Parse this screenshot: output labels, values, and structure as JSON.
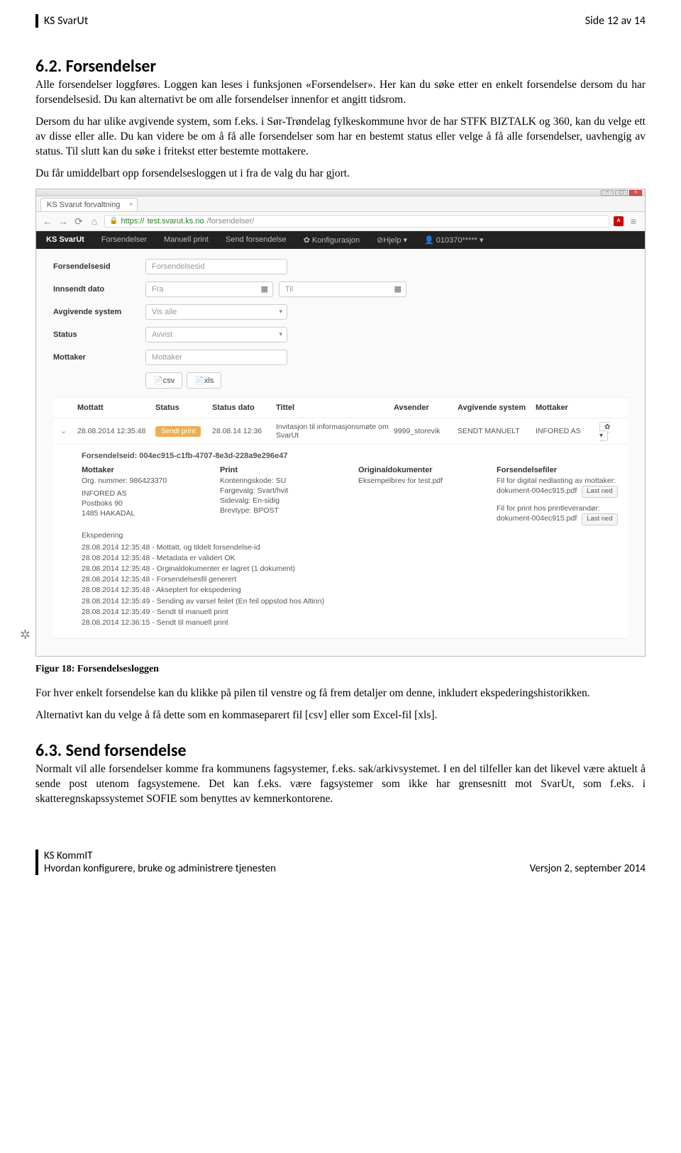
{
  "header": {
    "left": "KS SvarUt",
    "right": "Side 12 av 14"
  },
  "sec62": {
    "title": "6.2. Forsendelser",
    "p1": "Alle forsendelser loggføres. Loggen kan leses i funksjonen «Forsendelser». Her kan du søke etter en enkelt forsendelse dersom du har forsendelsesid. Du kan alternativt be om alle forsendelser innenfor et angitt tidsrom.",
    "p2": "Dersom du har ulike avgivende system, som f.eks. i Sør-Trøndelag fylkeskommune hvor de har STFK BIZTALK og 360, kan du velge ett av disse eller alle. Du kan videre be om å få alle forsendelser som har en bestemt status eller velge å få alle forsendelser, uavhengig av status. Til slutt kan du søke i fritekst etter bestemte mottakere.",
    "p3": "Du får umiddelbart opp forsendelsesloggen ut i fra de valg du har gjort."
  },
  "browser": {
    "tab_title": "KS Svarut forvaltning",
    "url_secure": "https://",
    "url_host": "test.svarut.ks.no",
    "url_path": "/forsendelser/"
  },
  "nav": {
    "brand": "KS SvarUt",
    "items": [
      "Forsendelser",
      "Manuell print",
      "Send forsendelse",
      "✿ Konfigurasjon",
      "⊘Hjelp ▾",
      "👤 010370***** ▾"
    ]
  },
  "filters": {
    "l_id": "Forsendelsesid",
    "ph_id": "Forsendelsesid",
    "l_date": "Innsendt dato",
    "ph_from": "Fra",
    "ph_to": "Til",
    "l_sys": "Avgivende system",
    "v_sys": "Vis alle",
    "l_status": "Status",
    "v_status": "Avvist",
    "l_mottaker": "Mottaker",
    "ph_mottaker": "Mottaker",
    "btn_csv": "📄csv",
    "btn_xls": "📄xls"
  },
  "table": {
    "h_mottatt": "Mottatt",
    "h_status": "Status",
    "h_statusdato": "Status dato",
    "h_tittel": "Tittel",
    "h_avsender": "Avsender",
    "h_avg": "Avgivende system",
    "h_mottaker": "Mottaker",
    "row": {
      "mottatt": "28.08.2014 12:35:48",
      "status": "Sendt print",
      "statusdato": "28.08.14 12:36",
      "tittel": "Invitasjon til informasjonsmøte om SvarUt",
      "avsender": "9999_storevik",
      "avg": "SENDT MANUELT",
      "mottaker": "INFORED AS"
    }
  },
  "detail": {
    "fid_label": "Forsendelseid: ",
    "fid": "004ec915-c1fb-4707-8e3d-228a9e296e47",
    "mottaker_h": "Mottaker",
    "mottaker_lines": [
      "Org. nummer: 986423370",
      "INFORED AS",
      "Postboks 90",
      "1485 HAKADAL"
    ],
    "print_h": "Print",
    "print_lines": [
      "Konteringskode: SU",
      "Fargevalg: Svart/hvit",
      "Sidevalg: En-sidig",
      "Brevtype: BPOST"
    ],
    "orig_h": "Originaldokumenter",
    "orig_lines": [
      "Eksempelbrev for test.pdf"
    ],
    "filer_h": "Forsendelsefiler",
    "filer_l1": "Fil for digital nedlasting av mottaker:",
    "filer_f1": "dokument-004ec915.pdf",
    "filer_l2": "Fil for print hos printleverandør:",
    "filer_f2": "dokument-004ec915.pdf",
    "dl": "Last ned",
    "eksp_h": "Ekspedering",
    "logs": [
      "28.08.2014 12:35:48 - Mottatt, og tildelt forsendelse-id",
      "28.08.2014 12:35:48 - Metadata er validert OK",
      "28.08.2014 12:35:48 - Orginaldokumenter er lagret (1 dokument)",
      "28.08.2014 12:35:48 - Forsendelsesfil generert",
      "28.08.2014 12:35:48 - Akseptert for ekspedering",
      "28.08.2014 12:35:49 - Sending av varsel feilet (En feil oppstod hos Altinn)",
      "28.08.2014 12:35:49 - Sendt til manuell print",
      "28.08.2014 12:36:15 - Sendt til manuell print"
    ]
  },
  "caption": "Figur 18: Forsendelsesloggen",
  "after": {
    "p1": "For hver enkelt forsendelse kan du klikke på pilen til venstre og få frem detaljer om denne, inkludert ekspederingshistorikken.",
    "p2": "Alternativt kan du velge å få dette som en kommaseparert fil [csv] eller som Excel-fil [xls]."
  },
  "sec63": {
    "title": "6.3. Send forsendelse",
    "p1": "Normalt vil alle forsendelser komme fra kommunens fagsystemer, f.eks. sak/arkivsystemet. I en del tilfeller kan det likevel være aktuelt å sende post utenom fagsystemene. Det kan f.eks. være fagsystemer som ikke har grensesnitt mot SvarUt, som f.eks. i skatteregnskapssystemet SOFIE som benyttes av kemnerkontorene."
  },
  "footer": {
    "l1": "KS KommIT",
    "l2": "Hvordan konfigurere, bruke og administrere tjenesten",
    "r": "Versjon 2, september 2014"
  }
}
